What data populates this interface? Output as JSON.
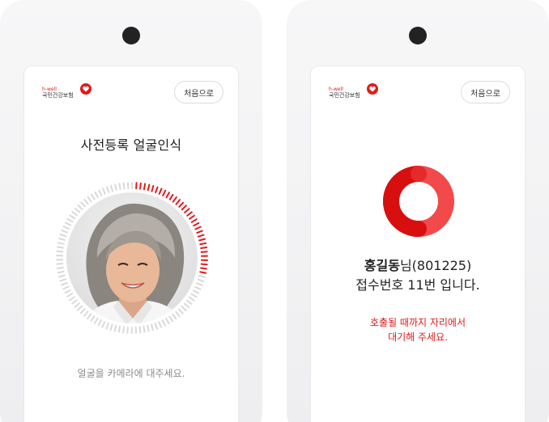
{
  "left_screen": {
    "logo": {
      "small": "h-well",
      "text": "국민건강보험"
    },
    "home_button": "처음으로",
    "title": "사전등록 얼굴인식",
    "scan_progress": 0.28,
    "hint": "얼굴을 카메라에 대주세요."
  },
  "right_screen": {
    "logo": {
      "small": "h-well",
      "text": "국민건강보험"
    },
    "home_button": "처음으로",
    "name": "홍길동",
    "name_suffix": "님(801225)",
    "reception_line": "접수번호 11번 입니다.",
    "notice_line1": "호출될 때까지 자리에서",
    "notice_line2": "대기해 주세요."
  },
  "colors": {
    "brand_red": "#e21a1a",
    "donut_dark": "#d80f0f",
    "donut_light": "#f24a4a",
    "tick_gray": "#d9d9dc"
  },
  "icons": [
    "heart-logo-icon",
    "face-scan-ring-icon",
    "loading-donut-icon"
  ]
}
